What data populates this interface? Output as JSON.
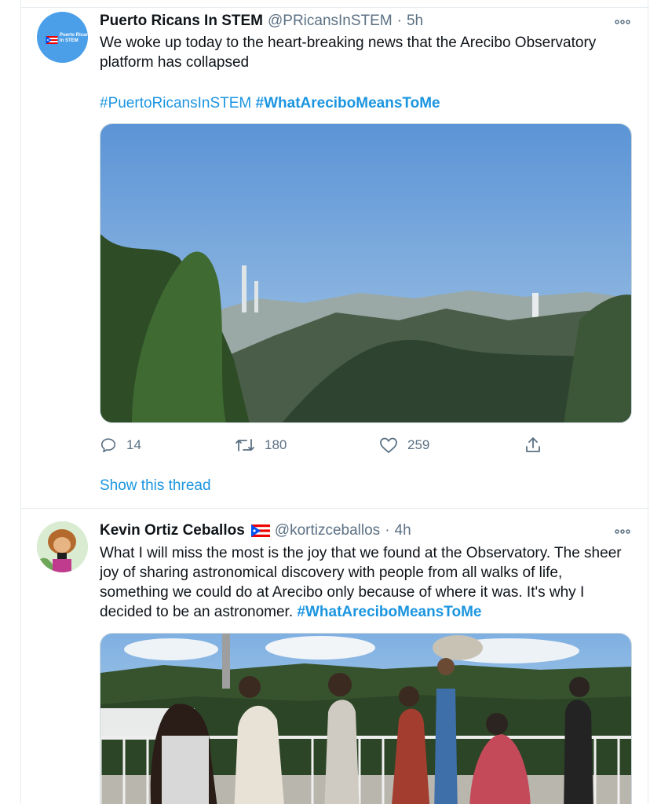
{
  "tweets": [
    {
      "author": {
        "name": "Puerto Ricans In STEM",
        "handle": "@PRicansInSTEM",
        "avatar_text": "Puerto Ricans\nIn STEM"
      },
      "separator": "·",
      "time": "5h",
      "text": "We woke up today to the heart-breaking news that the Arecibo Observatory platform has collapsed",
      "hashtags": [
        "#PuertoRicansInSTEM",
        "#WhatAreciboMeansToMe"
      ],
      "stats": {
        "replies": "14",
        "retweets": "180",
        "likes": "259"
      },
      "show_thread": "Show this thread"
    },
    {
      "author": {
        "name": "Kevin Ortiz Ceballos",
        "handle": "@kortizceballos"
      },
      "separator": "·",
      "time": "4h",
      "text": "What I will miss the most is the joy that we found at the Observatory. The sheer joy of sharing astronomical discovery with people from all walks of life, something we could do at Arecibo only because of where it was. It's why I decided to be an astronomer.",
      "hashtag": "#WhatAreciboMeansToMe"
    }
  ],
  "icons": [
    "more-icon",
    "reply-icon",
    "retweet-icon",
    "like-icon",
    "share-icon",
    "puerto-rico-flag-icon"
  ],
  "colors": {
    "link": "#1b95e0",
    "muted": "#5b7083",
    "text": "#0f1419",
    "border": "#e6ecf0"
  }
}
